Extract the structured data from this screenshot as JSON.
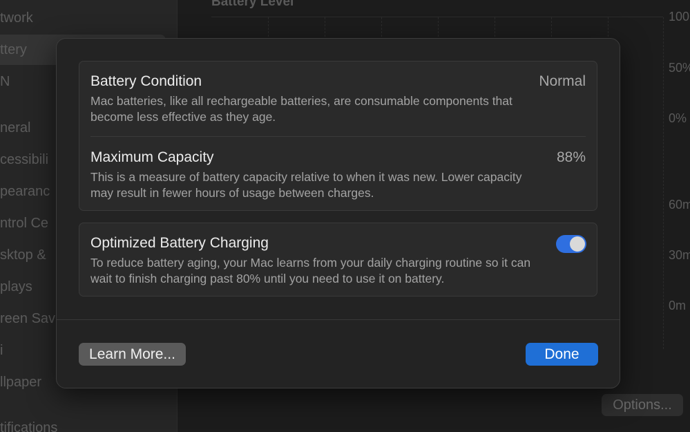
{
  "background": {
    "sidebar_items": [
      {
        "label": "twork"
      },
      {
        "label": "ttery"
      },
      {
        "label": "N"
      },
      {
        "label": "neral"
      },
      {
        "label": "cessibili"
      },
      {
        "label": "pearanc"
      },
      {
        "label": "ntrol Ce"
      },
      {
        "label": "sktop &"
      },
      {
        "label": "plays"
      },
      {
        "label": "reen Sav"
      },
      {
        "label": "i"
      },
      {
        "label": "llpaper"
      },
      {
        "label": "tifications"
      }
    ],
    "section_title": "Battery Level",
    "ticks": [
      "100",
      "50%",
      "0%",
      "60m",
      "30m",
      "0m"
    ],
    "options_label": "Options..."
  },
  "modal": {
    "battery_condition": {
      "title": "Battery Condition",
      "value": "Normal",
      "description": "Mac batteries, like all rechargeable batteries, are consumable components that become less effective as they age."
    },
    "maximum_capacity": {
      "title": "Maximum Capacity",
      "value": "88%",
      "description": "This is a measure of battery capacity relative to when it was new. Lower capacity may result in fewer hours of usage between charges."
    },
    "optimized_charging": {
      "title": "Optimized Battery Charging",
      "enabled": true,
      "description": "To reduce battery aging, your Mac learns from your daily charging routine so it can wait to finish charging past 80% until you need to use it on battery."
    },
    "learn_more_label": "Learn More...",
    "done_label": "Done"
  },
  "colors": {
    "accent": "#1f6fd6",
    "toggle_on": "#2f6fe0"
  }
}
